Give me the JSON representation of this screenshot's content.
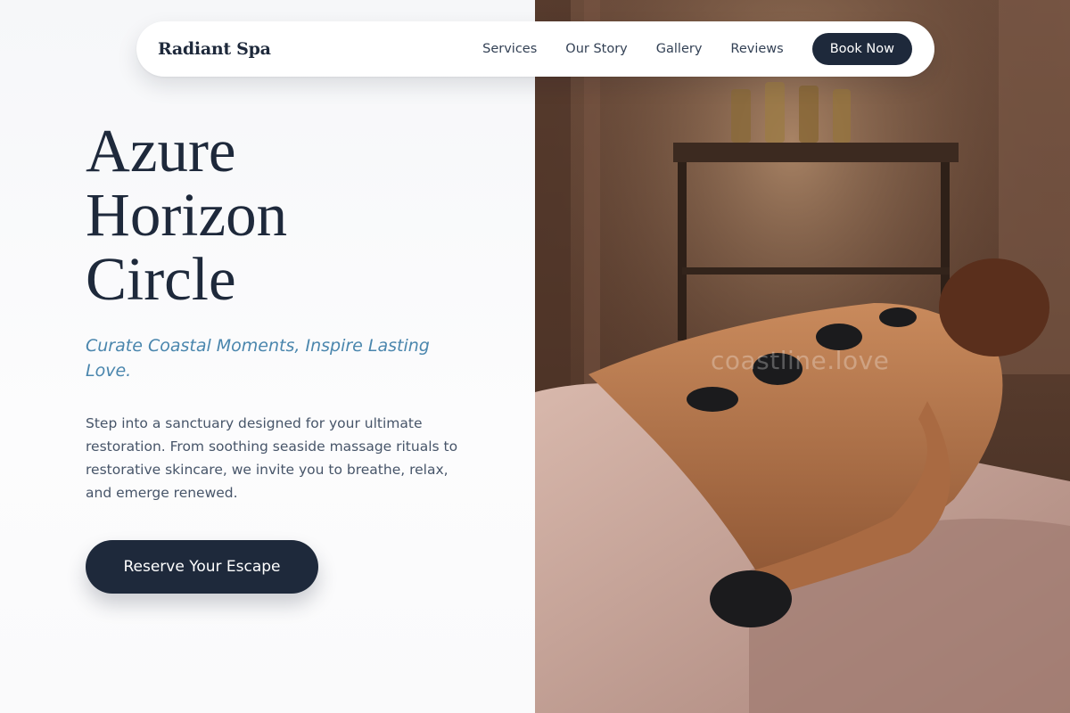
{
  "nav": {
    "brand": "Radiant Spa",
    "links": [
      "Services",
      "Our Story",
      "Gallery",
      "Reviews"
    ],
    "cta": "Book Now"
  },
  "hero": {
    "title_lines": [
      "Azure",
      "Horizon",
      "Circle"
    ],
    "tagline": "Curate Coastal Moments, Inspire Lasting Love.",
    "description": "Step into a sanctuary designed for your ultimate restoration. From soothing seaside massage rituals to restorative skincare, we invite you to breathe, relax, and emerge renewed.",
    "cta": "Reserve Your Escape"
  },
  "photo": {
    "subject": "hot stone massage",
    "watermark": "coastline.love"
  },
  "colors": {
    "navy": "#1e293b",
    "tagline_blue": "#4a86ad",
    "body_text": "#475569",
    "background": "#fafbfc"
  }
}
